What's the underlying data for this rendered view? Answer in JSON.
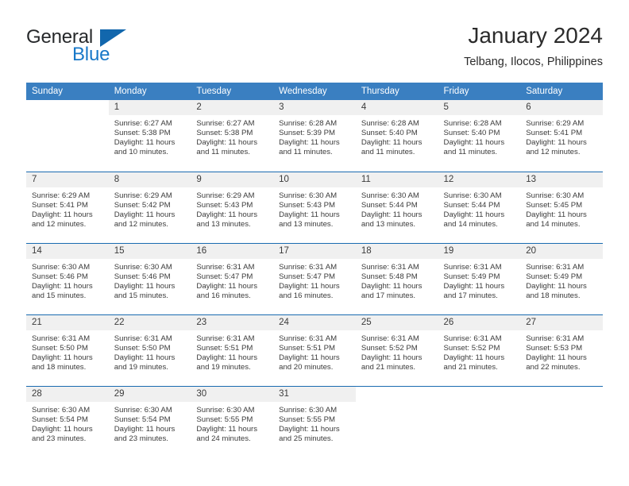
{
  "brand": {
    "name_part1": "General",
    "name_part2": "Blue",
    "logo_icon": "triangle-flag-icon"
  },
  "header": {
    "title": "January 2024",
    "location": "Telbang, Ilocos, Philippines"
  },
  "colors": {
    "header_row_bg": "#3a7fc1",
    "row_divider": "#1a6bb0",
    "daynum_bg": "#f0f0f0",
    "brand_blue": "#1878c8",
    "text": "#3b3b3b"
  },
  "calendar": {
    "weekday_headers": [
      "Sunday",
      "Monday",
      "Tuesday",
      "Wednesday",
      "Thursday",
      "Friday",
      "Saturday"
    ],
    "weeks": [
      [
        {
          "day": "",
          "blank": true,
          "sunrise": "",
          "sunset": "",
          "daylight1": "",
          "daylight2": ""
        },
        {
          "day": "1",
          "sunrise": "Sunrise: 6:27 AM",
          "sunset": "Sunset: 5:38 PM",
          "daylight1": "Daylight: 11 hours",
          "daylight2": "and 10 minutes."
        },
        {
          "day": "2",
          "sunrise": "Sunrise: 6:27 AM",
          "sunset": "Sunset: 5:38 PM",
          "daylight1": "Daylight: 11 hours",
          "daylight2": "and 11 minutes."
        },
        {
          "day": "3",
          "sunrise": "Sunrise: 6:28 AM",
          "sunset": "Sunset: 5:39 PM",
          "daylight1": "Daylight: 11 hours",
          "daylight2": "and 11 minutes."
        },
        {
          "day": "4",
          "sunrise": "Sunrise: 6:28 AM",
          "sunset": "Sunset: 5:40 PM",
          "daylight1": "Daylight: 11 hours",
          "daylight2": "and 11 minutes."
        },
        {
          "day": "5",
          "sunrise": "Sunrise: 6:28 AM",
          "sunset": "Sunset: 5:40 PM",
          "daylight1": "Daylight: 11 hours",
          "daylight2": "and 11 minutes."
        },
        {
          "day": "6",
          "sunrise": "Sunrise: 6:29 AM",
          "sunset": "Sunset: 5:41 PM",
          "daylight1": "Daylight: 11 hours",
          "daylight2": "and 12 minutes."
        }
      ],
      [
        {
          "day": "7",
          "sunrise": "Sunrise: 6:29 AM",
          "sunset": "Sunset: 5:41 PM",
          "daylight1": "Daylight: 11 hours",
          "daylight2": "and 12 minutes."
        },
        {
          "day": "8",
          "sunrise": "Sunrise: 6:29 AM",
          "sunset": "Sunset: 5:42 PM",
          "daylight1": "Daylight: 11 hours",
          "daylight2": "and 12 minutes."
        },
        {
          "day": "9",
          "sunrise": "Sunrise: 6:29 AM",
          "sunset": "Sunset: 5:43 PM",
          "daylight1": "Daylight: 11 hours",
          "daylight2": "and 13 minutes."
        },
        {
          "day": "10",
          "sunrise": "Sunrise: 6:30 AM",
          "sunset": "Sunset: 5:43 PM",
          "daylight1": "Daylight: 11 hours",
          "daylight2": "and 13 minutes."
        },
        {
          "day": "11",
          "sunrise": "Sunrise: 6:30 AM",
          "sunset": "Sunset: 5:44 PM",
          "daylight1": "Daylight: 11 hours",
          "daylight2": "and 13 minutes."
        },
        {
          "day": "12",
          "sunrise": "Sunrise: 6:30 AM",
          "sunset": "Sunset: 5:44 PM",
          "daylight1": "Daylight: 11 hours",
          "daylight2": "and 14 minutes."
        },
        {
          "day": "13",
          "sunrise": "Sunrise: 6:30 AM",
          "sunset": "Sunset: 5:45 PM",
          "daylight1": "Daylight: 11 hours",
          "daylight2": "and 14 minutes."
        }
      ],
      [
        {
          "day": "14",
          "sunrise": "Sunrise: 6:30 AM",
          "sunset": "Sunset: 5:46 PM",
          "daylight1": "Daylight: 11 hours",
          "daylight2": "and 15 minutes."
        },
        {
          "day": "15",
          "sunrise": "Sunrise: 6:30 AM",
          "sunset": "Sunset: 5:46 PM",
          "daylight1": "Daylight: 11 hours",
          "daylight2": "and 15 minutes."
        },
        {
          "day": "16",
          "sunrise": "Sunrise: 6:31 AM",
          "sunset": "Sunset: 5:47 PM",
          "daylight1": "Daylight: 11 hours",
          "daylight2": "and 16 minutes."
        },
        {
          "day": "17",
          "sunrise": "Sunrise: 6:31 AM",
          "sunset": "Sunset: 5:47 PM",
          "daylight1": "Daylight: 11 hours",
          "daylight2": "and 16 minutes."
        },
        {
          "day": "18",
          "sunrise": "Sunrise: 6:31 AM",
          "sunset": "Sunset: 5:48 PM",
          "daylight1": "Daylight: 11 hours",
          "daylight2": "and 17 minutes."
        },
        {
          "day": "19",
          "sunrise": "Sunrise: 6:31 AM",
          "sunset": "Sunset: 5:49 PM",
          "daylight1": "Daylight: 11 hours",
          "daylight2": "and 17 minutes."
        },
        {
          "day": "20",
          "sunrise": "Sunrise: 6:31 AM",
          "sunset": "Sunset: 5:49 PM",
          "daylight1": "Daylight: 11 hours",
          "daylight2": "and 18 minutes."
        }
      ],
      [
        {
          "day": "21",
          "sunrise": "Sunrise: 6:31 AM",
          "sunset": "Sunset: 5:50 PM",
          "daylight1": "Daylight: 11 hours",
          "daylight2": "and 18 minutes."
        },
        {
          "day": "22",
          "sunrise": "Sunrise: 6:31 AM",
          "sunset": "Sunset: 5:50 PM",
          "daylight1": "Daylight: 11 hours",
          "daylight2": "and 19 minutes."
        },
        {
          "day": "23",
          "sunrise": "Sunrise: 6:31 AM",
          "sunset": "Sunset: 5:51 PM",
          "daylight1": "Daylight: 11 hours",
          "daylight2": "and 19 minutes."
        },
        {
          "day": "24",
          "sunrise": "Sunrise: 6:31 AM",
          "sunset": "Sunset: 5:51 PM",
          "daylight1": "Daylight: 11 hours",
          "daylight2": "and 20 minutes."
        },
        {
          "day": "25",
          "sunrise": "Sunrise: 6:31 AM",
          "sunset": "Sunset: 5:52 PM",
          "daylight1": "Daylight: 11 hours",
          "daylight2": "and 21 minutes."
        },
        {
          "day": "26",
          "sunrise": "Sunrise: 6:31 AM",
          "sunset": "Sunset: 5:52 PM",
          "daylight1": "Daylight: 11 hours",
          "daylight2": "and 21 minutes."
        },
        {
          "day": "27",
          "sunrise": "Sunrise: 6:31 AM",
          "sunset": "Sunset: 5:53 PM",
          "daylight1": "Daylight: 11 hours",
          "daylight2": "and 22 minutes."
        }
      ],
      [
        {
          "day": "28",
          "sunrise": "Sunrise: 6:30 AM",
          "sunset": "Sunset: 5:54 PM",
          "daylight1": "Daylight: 11 hours",
          "daylight2": "and 23 minutes."
        },
        {
          "day": "29",
          "sunrise": "Sunrise: 6:30 AM",
          "sunset": "Sunset: 5:54 PM",
          "daylight1": "Daylight: 11 hours",
          "daylight2": "and 23 minutes."
        },
        {
          "day": "30",
          "sunrise": "Sunrise: 6:30 AM",
          "sunset": "Sunset: 5:55 PM",
          "daylight1": "Daylight: 11 hours",
          "daylight2": "and 24 minutes."
        },
        {
          "day": "31",
          "sunrise": "Sunrise: 6:30 AM",
          "sunset": "Sunset: 5:55 PM",
          "daylight1": "Daylight: 11 hours",
          "daylight2": "and 25 minutes."
        },
        {
          "day": "",
          "blank": true,
          "sunrise": "",
          "sunset": "",
          "daylight1": "",
          "daylight2": ""
        },
        {
          "day": "",
          "blank": true,
          "sunrise": "",
          "sunset": "",
          "daylight1": "",
          "daylight2": ""
        },
        {
          "day": "",
          "blank": true,
          "sunrise": "",
          "sunset": "",
          "daylight1": "",
          "daylight2": ""
        }
      ]
    ]
  }
}
